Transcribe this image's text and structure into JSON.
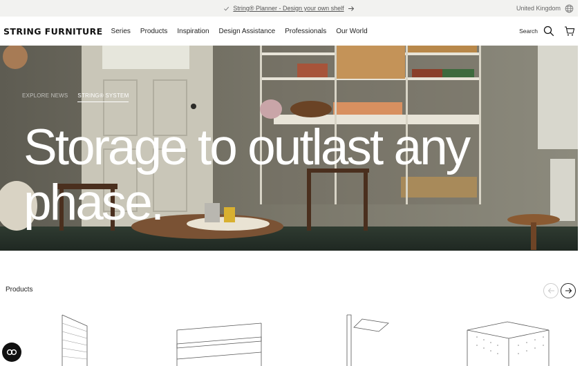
{
  "promo": {
    "text": "String® Planner - Design your own shelf",
    "region": "United Kingdom"
  },
  "header": {
    "logo": "STRING FURNITURE",
    "nav": [
      "Series",
      "Products",
      "Inspiration",
      "Design Assistance",
      "Professionals",
      "Our World"
    ],
    "search_label": "Search"
  },
  "hero": {
    "tabs": [
      "EXPLORE NEWS",
      "STRING® SYSTEM"
    ],
    "active_tab": 1,
    "title_line1": "Storage to outlast any",
    "title_line2": "phase."
  },
  "products": {
    "section_label": "Products"
  },
  "colors": {
    "accent": "#111111",
    "hero_text": "#ffffff",
    "promo_bg": "#f2f2f0"
  },
  "icons": [
    "check-icon",
    "arrow-right-icon",
    "globe-icon",
    "search-icon",
    "cart-icon",
    "arrow-left-icon",
    "chat-icon"
  ]
}
